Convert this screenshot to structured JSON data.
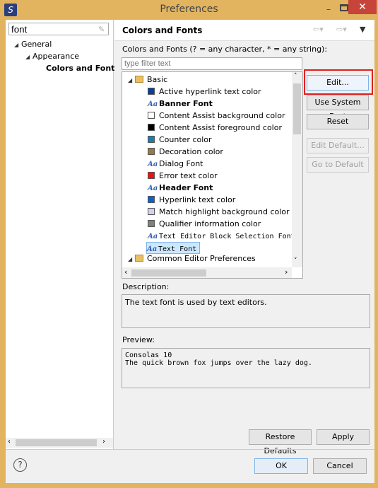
{
  "window": {
    "title": "Preferences"
  },
  "left": {
    "search_value": "font",
    "tree": [
      {
        "label": "General",
        "level": 0
      },
      {
        "label": "Appearance",
        "level": 1
      },
      {
        "label": "Colors and Fonts",
        "level": 2,
        "selected": true
      }
    ]
  },
  "page": {
    "title": "Colors and Fonts",
    "filter_label": "Colors and Fonts (? = any character, * = any string):",
    "filter_placeholder": "type filter text",
    "groups": {
      "basic": "Basic",
      "common": "Common Editor Preferences"
    },
    "items": [
      {
        "label": "Active hyperlink text color",
        "type": "color",
        "color": "#0a3f9a"
      },
      {
        "label": "Banner Font",
        "type": "font",
        "bold": true
      },
      {
        "label": "Content Assist background color",
        "type": "color",
        "color": "#ffffff"
      },
      {
        "label": "Content Assist foreground color",
        "type": "color",
        "color": "#000000"
      },
      {
        "label": "Counter color",
        "type": "color",
        "color": "#1a80a8"
      },
      {
        "label": "Decoration color",
        "type": "color",
        "color": "#957a4a"
      },
      {
        "label": "Dialog Font",
        "type": "font"
      },
      {
        "label": "Error text color",
        "type": "color",
        "color": "#ee1111"
      },
      {
        "label": "Header Font",
        "type": "font",
        "bold": true
      },
      {
        "label": "Hyperlink text color",
        "type": "color",
        "color": "#1060c8"
      },
      {
        "label": "Match highlight background color",
        "type": "color",
        "color": "#d4d0f0"
      },
      {
        "label": "Qualifier information color",
        "type": "color",
        "color": "#808080"
      },
      {
        "label": "Text Editor Block Selection Font",
        "type": "font",
        "mono": true
      },
      {
        "label": "Text Font",
        "type": "font",
        "mono": true,
        "selected": true
      }
    ],
    "buttons": {
      "edit": "Edit...",
      "use_system_font": "Use System Font",
      "reset": "Reset",
      "edit_default": "Edit Default...",
      "go_to_default": "Go to Default"
    },
    "description_label": "Description:",
    "description": "The text font is used by text editors.",
    "preview_label": "Preview:",
    "preview_lines": [
      "Consolas 10",
      "The quick brown fox jumps over the lazy dog."
    ],
    "restore_defaults": "Restore Defaults",
    "apply": "Apply"
  },
  "footer": {
    "ok": "OK",
    "cancel": "Cancel",
    "help_icon": "?"
  },
  "colors": {
    "highlight_border": "#e02020",
    "selection": "#cce8ff"
  }
}
